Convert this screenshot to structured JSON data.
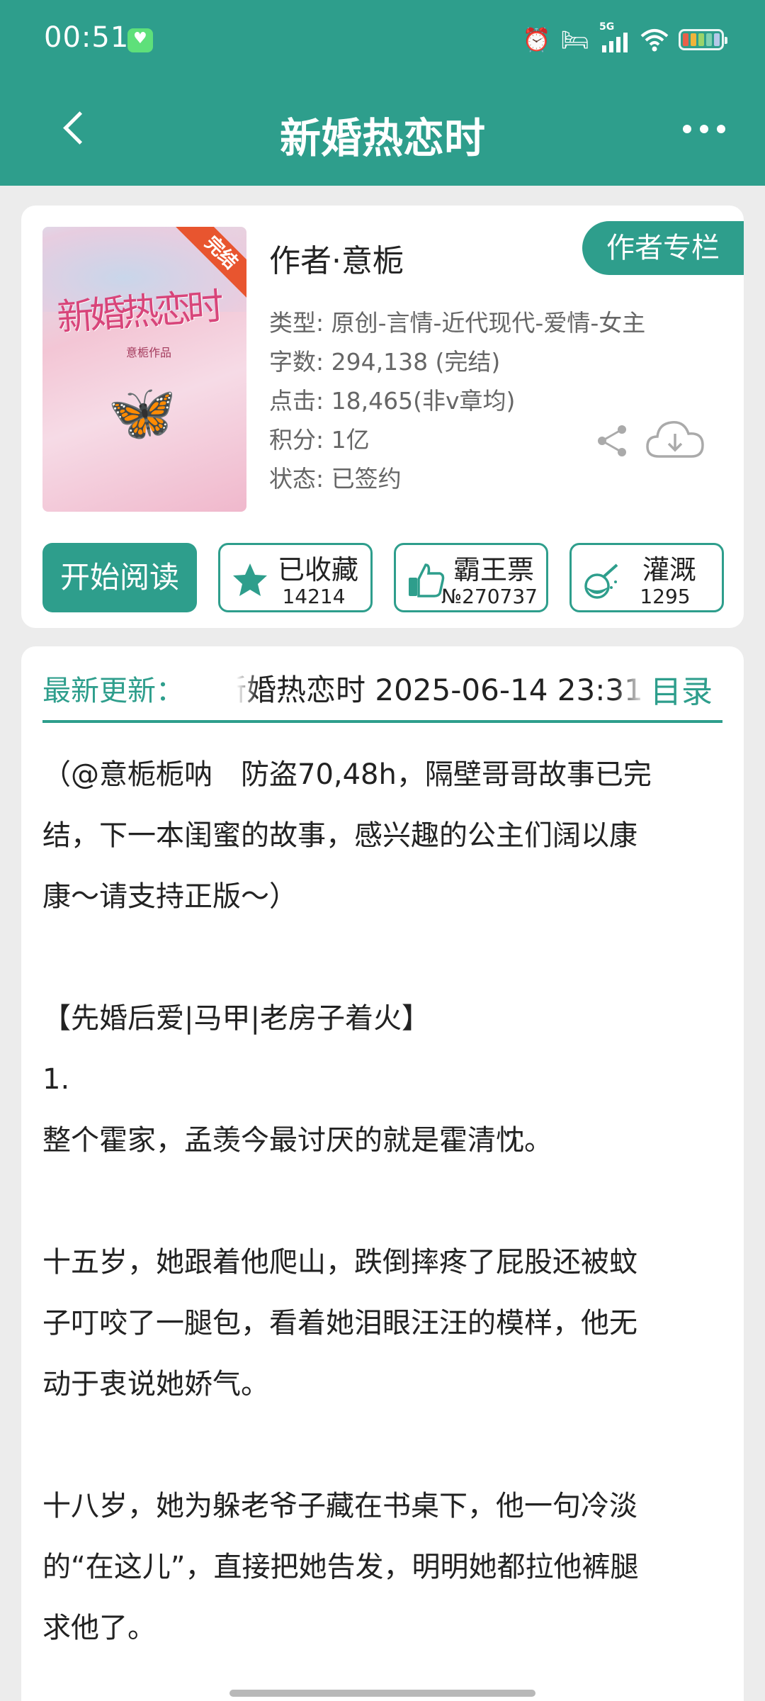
{
  "status_bar": {
    "time": "00:51",
    "network_label": "5G",
    "battery_colors": [
      "#e8604a",
      "#f0b43a",
      "#9ad36a",
      "#7fd0b0",
      "#b6c8e8"
    ]
  },
  "nav": {
    "title": "新婚热恋时"
  },
  "book": {
    "cover_title": "新婚热恋时",
    "cover_author": "意栀作品",
    "cover_badge": "完结",
    "author": "作者·意栀",
    "author_column_label": "作者专栏",
    "info": [
      "类型: 原创-言情-近代现代-爱情-女主",
      "字数: 294,138 (完结)",
      "点击: 18,465(非v章均)",
      "积分: 1亿",
      "状态: 已签约"
    ]
  },
  "actions": {
    "read_label": "开始阅读",
    "collect_label": "已收藏",
    "collect_count": "14214",
    "vote_label": "霸王票",
    "vote_count": "№270737",
    "water_label": "灌溉",
    "water_count": "1295"
  },
  "update": {
    "label": "最新更新：",
    "text": "新婚热恋时  2025-06-14 23:31 |",
    "toc_label": "目录"
  },
  "summary": [
    "（@意栀栀呐　防盗70,48h，隔壁哥哥故事已完",
    "结，下一本闺蜜的故事，感兴趣的公主们阔以康",
    "康～请支持正版～）",
    "",
    "【先婚后爱|马甲|老房子着火】",
    "1.",
    "整个霍家，孟羡今最讨厌的就是霍清忱。",
    "",
    "十五岁，她跟着他爬山，跌倒摔疼了屁股还被蚊",
    "子叮咬了一腿包，看着她泪眼汪汪的模样，他无",
    "动于衷说她娇气。",
    "",
    "十八岁，她为躲老爷子藏在书桌下，他一句冷淡",
    "的“在这儿”，直接把她告发，明明她都拉他裤腿",
    "求他了。"
  ],
  "colors": {
    "accent": "#2e9e8c"
  }
}
